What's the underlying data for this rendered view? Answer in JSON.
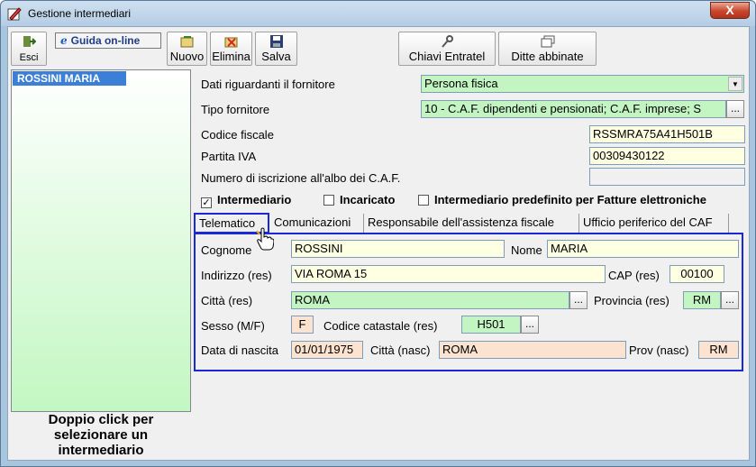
{
  "window": {
    "title": "Gestione intermediari",
    "close_label": "X"
  },
  "toolbar": {
    "esci_label": "Esci",
    "guida_label": "Guida on-line",
    "guida_icon": "e",
    "nuovo_label": "Nuovo",
    "elimina_label": "Elimina",
    "salva_label": "Salva",
    "chiavi_label": "Chiavi Entratel",
    "ditte_label": "Ditte abbinate"
  },
  "list": {
    "items": [
      "ROSSINI MARIA"
    ],
    "hint": "Doppio click per selezionare un intermediario"
  },
  "form": {
    "dati_label": "Dati riguardanti il fornitore",
    "dati_value": "Persona fisica",
    "tipo_label": "Tipo fornitore",
    "tipo_value": "10 - C.A.F. dipendenti e pensionati; C.A.F. imprese; S",
    "cf_label": "Codice fiscale",
    "cf_value": "RSSMRA75A41H501B",
    "piva_label": "Partita IVA",
    "piva_value": "00309430122",
    "albo_label": "Numero di iscrizione all'albo dei C.A.F.",
    "albo_value": "",
    "dots_label": "..."
  },
  "checks": [
    {
      "label": "Intermediario",
      "checked": true
    },
    {
      "label": "Incaricato",
      "checked": false
    },
    {
      "label": "Intermediario predefinito per Fatture elettroniche",
      "checked": false
    }
  ],
  "tabs": [
    "Telematico",
    "Comunicazioni",
    "Responsabile dell'assistenza fiscale",
    "Ufficio periferico del CAF"
  ],
  "telematico": {
    "cognome_label": "Cognome",
    "cognome_value": "ROSSINI",
    "nome_label": "Nome",
    "nome_value": "MARIA",
    "indirizzo_label": "Indirizzo (res)",
    "indirizzo_value": "VIA ROMA 15",
    "cap_label": "CAP (res)",
    "cap_value": "00100",
    "citta_label": "Città (res)",
    "citta_value": "ROMA",
    "prov_label": "Provincia (res)",
    "prov_value": "RM",
    "sesso_label": "Sesso (M/F)",
    "sesso_value": "F",
    "catastale_label": "Codice catastale (res)",
    "catastale_value": "H501",
    "nascita_label": "Data di nascita",
    "nascita_value": "01/01/1975",
    "citta_nasc_label": "Città (nasc)",
    "citta_nasc_value": "ROMA",
    "prov_nasc_label": "Prov (nasc)",
    "prov_nasc_value": "RM"
  },
  "colors": {
    "accent_blue": "#1a28d9",
    "green_field": "#c3f5c3",
    "yellow_field": "#ffffe1",
    "peach_field": "#fce3cf"
  }
}
